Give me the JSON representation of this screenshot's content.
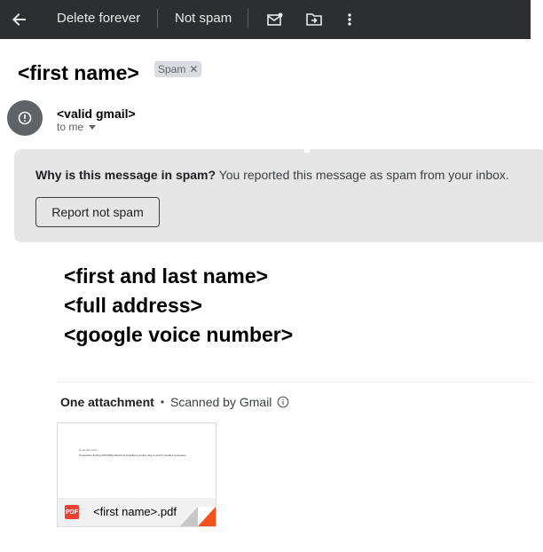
{
  "toolbar": {
    "delete_forever": "Delete forever",
    "not_spam": "Not spam"
  },
  "subject": "<first name>",
  "label": "Spam",
  "sender": "<valid gmail>",
  "recipient": "to me",
  "spam_notice": {
    "question": "Why is this message in spam?",
    "explanation": " You reported this message as spam from your inbox.",
    "button": "Report not spam"
  },
  "body": {
    "line1": "<first and last name>",
    "line2": "<full address>",
    "line3": "<google voice number>"
  },
  "attachments": {
    "count_label": "One attachment",
    "scan_label": "Scanned by Gmail",
    "file_name": "<first name>.pdf",
    "thumb_title": "Rosterfile Redo",
    "thumb_line": "Proposition finding PROVEN discuss & simplifies a better way to work if needed composes"
  },
  "colors": {
    "toolbar_bg": "#2d2e30",
    "spam_box_bg": "#e6e6e6",
    "pdf_red": "#ea4335"
  }
}
